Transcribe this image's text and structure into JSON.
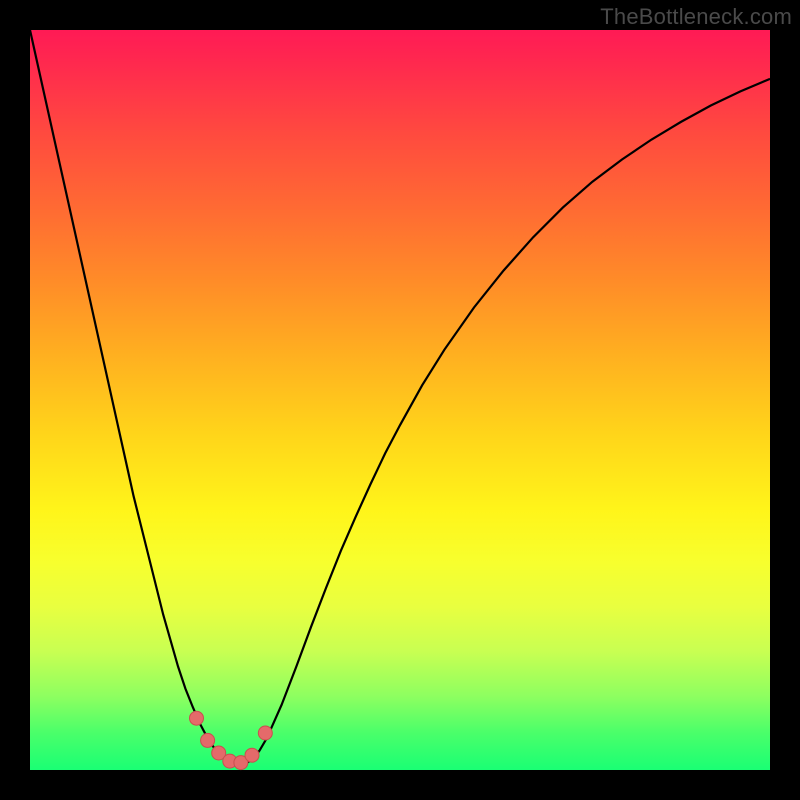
{
  "watermark": "TheBottleneck.com",
  "colors": {
    "frame_bg": "#000000",
    "curve_stroke": "#000000",
    "marker_fill": "#e46a6a",
    "marker_stroke": "#c94f4f"
  },
  "chart_data": {
    "type": "line",
    "title": "",
    "xlabel": "",
    "ylabel": "",
    "xlim": [
      0,
      100
    ],
    "ylim": [
      0,
      100
    ],
    "x": [
      0,
      2,
      4,
      6,
      8,
      10,
      12,
      14,
      16,
      18,
      20,
      21,
      22,
      23,
      24,
      25,
      26,
      27,
      28,
      29,
      30,
      31,
      32,
      34,
      36,
      38,
      40,
      42,
      44,
      46,
      48,
      50,
      53,
      56,
      60,
      64,
      68,
      72,
      76,
      80,
      84,
      88,
      92,
      96,
      100
    ],
    "y": [
      100,
      91,
      82,
      73,
      64,
      55,
      46,
      37,
      29,
      21,
      14,
      11,
      8.5,
      6.2,
      4.3,
      2.8,
      1.7,
      1.0,
      0.6,
      0.8,
      1.4,
      2.6,
      4.3,
      8.8,
      14.0,
      19.4,
      24.6,
      29.6,
      34.2,
      38.6,
      42.8,
      46.6,
      52.0,
      56.8,
      62.5,
      67.5,
      72.0,
      76.0,
      79.5,
      82.5,
      85.2,
      87.6,
      89.8,
      91.7,
      93.4
    ],
    "markers": {
      "x": [
        22.5,
        24.0,
        25.5,
        27.0,
        28.5,
        30.0,
        31.8
      ],
      "y": [
        7.0,
        4.0,
        2.3,
        1.2,
        1.0,
        2.0,
        5.0
      ]
    }
  }
}
